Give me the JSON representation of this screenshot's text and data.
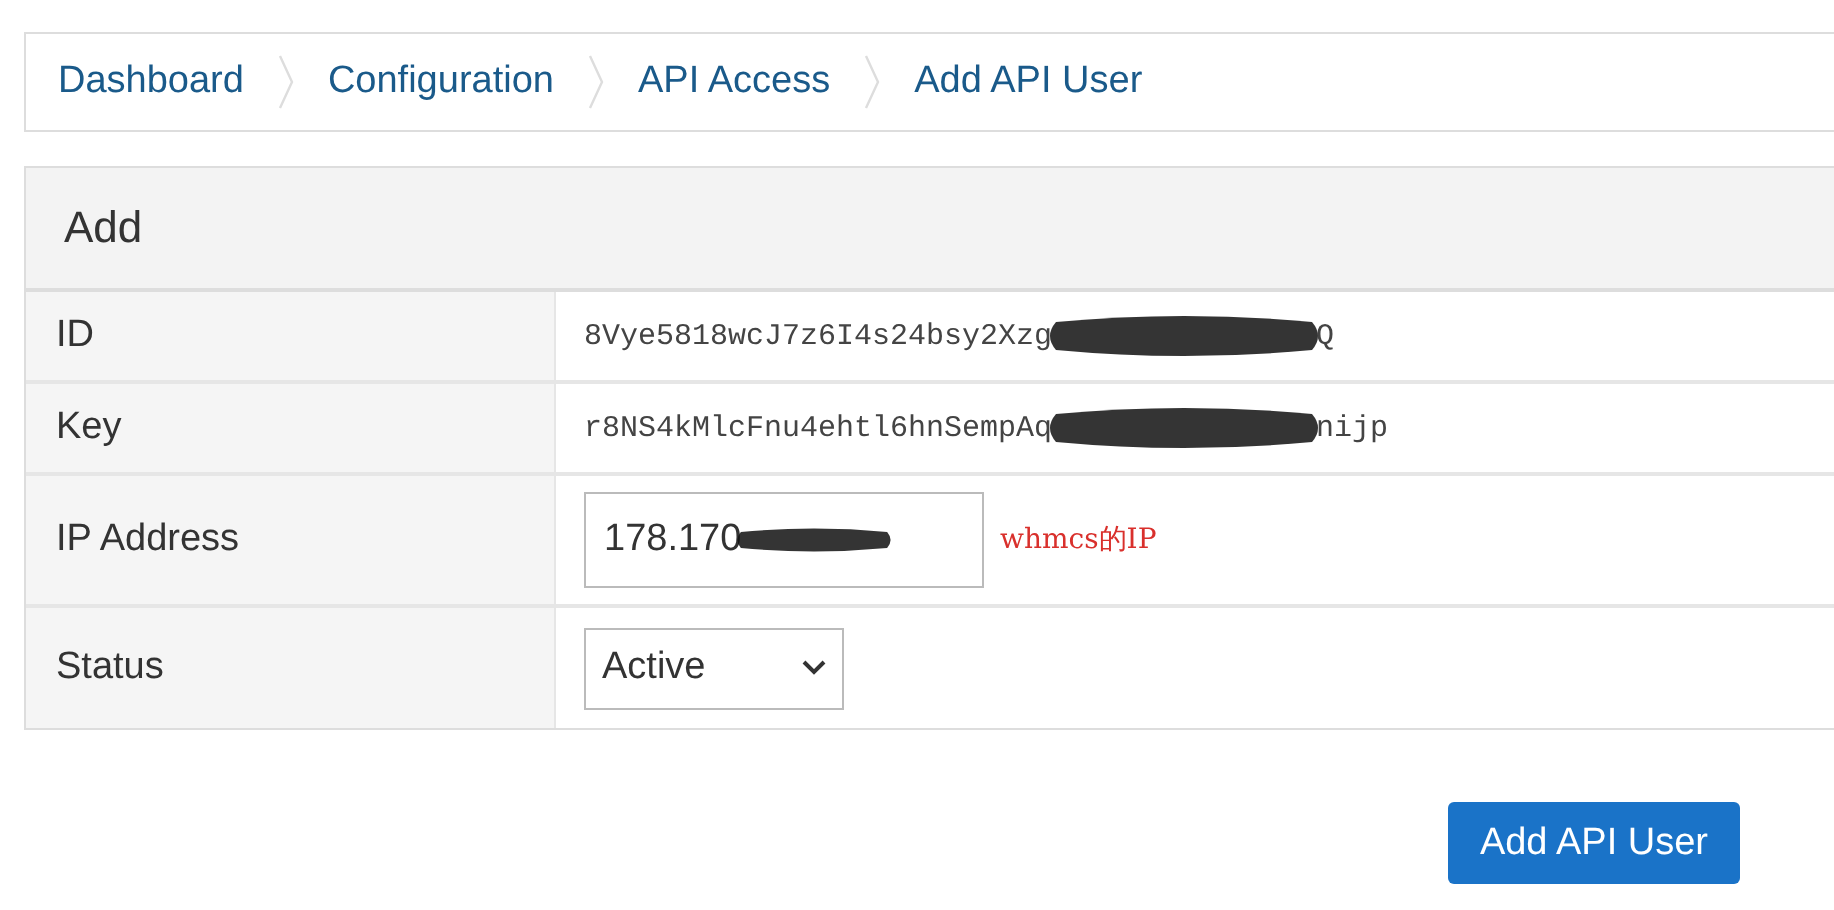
{
  "breadcrumb": [
    {
      "label": "Dashboard"
    },
    {
      "label": "Configuration"
    },
    {
      "label": "API Access"
    },
    {
      "label": "Add API User"
    }
  ],
  "panel": {
    "title": "Add",
    "rows": [
      {
        "kind": "text",
        "label": "ID",
        "value_start": "8Vye5818wcJ7z6I4s24bsy2Xzg",
        "value_end": "Q"
      },
      {
        "kind": "text",
        "label": "Key",
        "value_start": "r8NS4kMlcFnu4ehtl6hnSempAq",
        "value_end": "nijp"
      },
      {
        "kind": "input",
        "label": "IP Address",
        "value_start": "178.170",
        "note": "whmcs的IP"
      },
      {
        "kind": "select",
        "label": "Status",
        "value_start": "Active"
      }
    ]
  },
  "submit_button": "Add API User"
}
